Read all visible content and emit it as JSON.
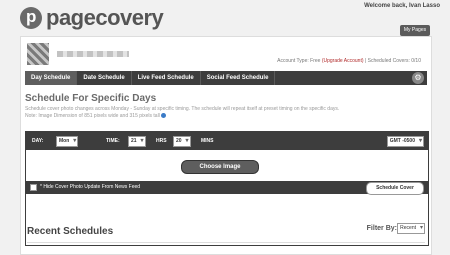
{
  "header": {
    "logo_text": "pagecovery",
    "welcome": "Welcome back, Ivan Lasso",
    "my_pages": "My Pages"
  },
  "account": {
    "type_label": "Account Type:",
    "type_value": "Free",
    "upgrade": "(Upgrade Account)",
    "separator": "|",
    "scheduled": "Scheduled Covers: 0/10"
  },
  "tabs": [
    {
      "label": "Day Schedule"
    },
    {
      "label": "Date Schedule"
    },
    {
      "label": "Live Feed Schedule"
    },
    {
      "label": "Social Feed Schedule"
    }
  ],
  "main": {
    "title": "Schedule For Specific Days",
    "description": "Schedule cover photo changes across Monday - Sunday at specific timing. The schedule will repeat itself at preset timing on the specific days.",
    "note": "Note: Image Dimension of 851 pixels wide and 315 pixels tall"
  },
  "schedule": {
    "day_label": "DAY:",
    "day_value": "Mon",
    "time_label": "TIME:",
    "hour_value": "21",
    "hrs_label": "HRS",
    "min_value": "20",
    "mins_label": "MINS",
    "tz_value": "GMT -0500",
    "choose_image": "Choose Image",
    "hide_label": "* Hide Cover Photo Update From News Feed",
    "schedule_button": "Schedule Cover"
  },
  "recent": {
    "title": "Recent Schedules",
    "filter_label": "Filter By:",
    "filter_value": "Recent"
  }
}
